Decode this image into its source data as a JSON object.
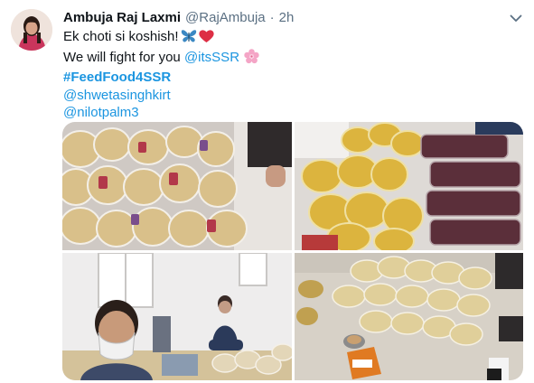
{
  "tweet": {
    "author_name": "Ambuja Raj Laxmi",
    "handle": "@RajAmbuja",
    "separator": "·",
    "time": "2h",
    "line1_text": "Ek choti si koshish!",
    "line2_text": "We will fight for you ",
    "mention_ssr": "@itsSSR",
    "hashtag": "#FeedFood4SSR",
    "mention_1": "@shwetasinghkirt",
    "mention_2": "@nilotpalm3"
  },
  "icons": [
    "avatar",
    "chevron-down-icon",
    "butterfly-emoji",
    "heart-emoji",
    "cherry-blossom-emoji"
  ],
  "colors": {
    "link": "#1b95e0",
    "secondary": "#5b7083",
    "text": "#0f1419"
  },
  "media": [
    {
      "description_name": "photo-food-packets-1"
    },
    {
      "description_name": "photo-food-packets-2"
    },
    {
      "description_name": "photo-volunteers"
    },
    {
      "description_name": "photo-food-packets-floor"
    }
  ]
}
